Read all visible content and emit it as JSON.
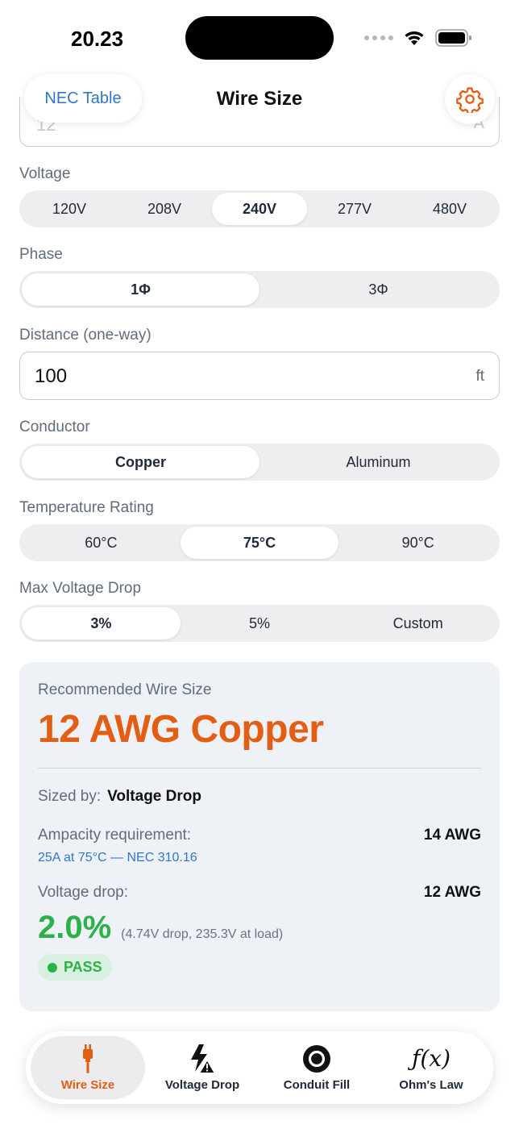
{
  "status_bar": {
    "time": "20.23"
  },
  "nav": {
    "left_button": "NEC Table",
    "title": "Wire Size",
    "settings_icon": "gear-icon"
  },
  "scrolled_field": {
    "value": "12",
    "unit": "A"
  },
  "voltage": {
    "label": "Voltage",
    "options": [
      "120V",
      "208V",
      "240V",
      "277V",
      "480V"
    ],
    "selected": "240V"
  },
  "phase": {
    "label": "Phase",
    "options": [
      "1Φ",
      "3Φ"
    ],
    "selected": "1Φ"
  },
  "distance": {
    "label": "Distance (one-way)",
    "value": "100",
    "unit": "ft"
  },
  "conductor": {
    "label": "Conductor",
    "options": [
      "Copper",
      "Aluminum"
    ],
    "selected": "Copper"
  },
  "temperature": {
    "label": "Temperature Rating",
    "options": [
      "60°C",
      "75°C",
      "90°C"
    ],
    "selected": "75°C"
  },
  "max_drop": {
    "label": "Max Voltage Drop",
    "options": [
      "3%",
      "5%",
      "Custom"
    ],
    "selected": "3%"
  },
  "result": {
    "caption": "Recommended Wire Size",
    "value": "12 AWG Copper",
    "sized_by_label": "Sized by:",
    "sized_by_value": "Voltage Drop",
    "ampacity_label": "Ampacity requirement:",
    "ampacity_value": "14 AWG",
    "ampacity_note": "25A at 75°C — NEC 310.16",
    "vd_label": "Voltage drop:",
    "vd_value": "12 AWG",
    "vd_percent": "2.0%",
    "vd_detail": "(4.74V drop, 235.3V at load)",
    "status": "PASS"
  },
  "colors": {
    "accent": "#e35d12",
    "link": "#2f76c9",
    "pass": "#2bb14a"
  },
  "tabs": [
    {
      "label": "Wire Size",
      "icon": "plug-icon",
      "active": true
    },
    {
      "label": "Voltage Drop",
      "icon": "bolt-warning-icon",
      "active": false
    },
    {
      "label": "Conduit Fill",
      "icon": "conduit-icon",
      "active": false
    },
    {
      "label": "Ohm's Law",
      "icon": "function-icon",
      "active": false
    }
  ]
}
